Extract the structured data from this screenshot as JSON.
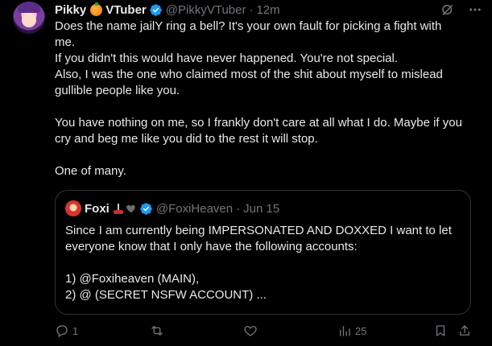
{
  "tweet": {
    "display_name": "Pikky",
    "display_name_suffix": "VTuber",
    "handle": "@PikkyVTuber",
    "time": "12m",
    "lines": [
      "Does the name jailY ring a bell? It's your own fault for picking a fight with",
      "me.",
      "If you didn't this would have never happened. You're not special.",
      "Also, I was the one who claimed most of the shit about myself to mislead",
      "gullible people like you.",
      "",
      "You have nothing on me, so I frankly don't care at all what I do. Maybe if you",
      "cry and beg me like you did to the rest it will stop.",
      "",
      "One of many."
    ]
  },
  "quote": {
    "display_name": "Foxi",
    "handle": "@FoxiHeaven",
    "date": "Jun 15",
    "lines": [
      "Since I am currently being IMPERSONATED AND DOXXED I want to let",
      "everyone know that I only have the following accounts:",
      "",
      "1) @Foxiheaven (MAIN),",
      "2) @ (SECRET NSFW ACCOUNT) ..."
    ]
  },
  "actions": {
    "reply_count": "1",
    "views_count": "25"
  },
  "icons": {
    "top": [
      "grok-icon",
      "more-icon"
    ],
    "actions": [
      "reply-icon",
      "retweet-icon",
      "like-icon",
      "views-icon",
      "bookmark-icon",
      "share-icon"
    ]
  },
  "colors": {
    "background": "#000000",
    "text": "#e7e9ea",
    "muted": "#71767b",
    "verified": "#1d9bf0",
    "border": "#2f3336"
  }
}
